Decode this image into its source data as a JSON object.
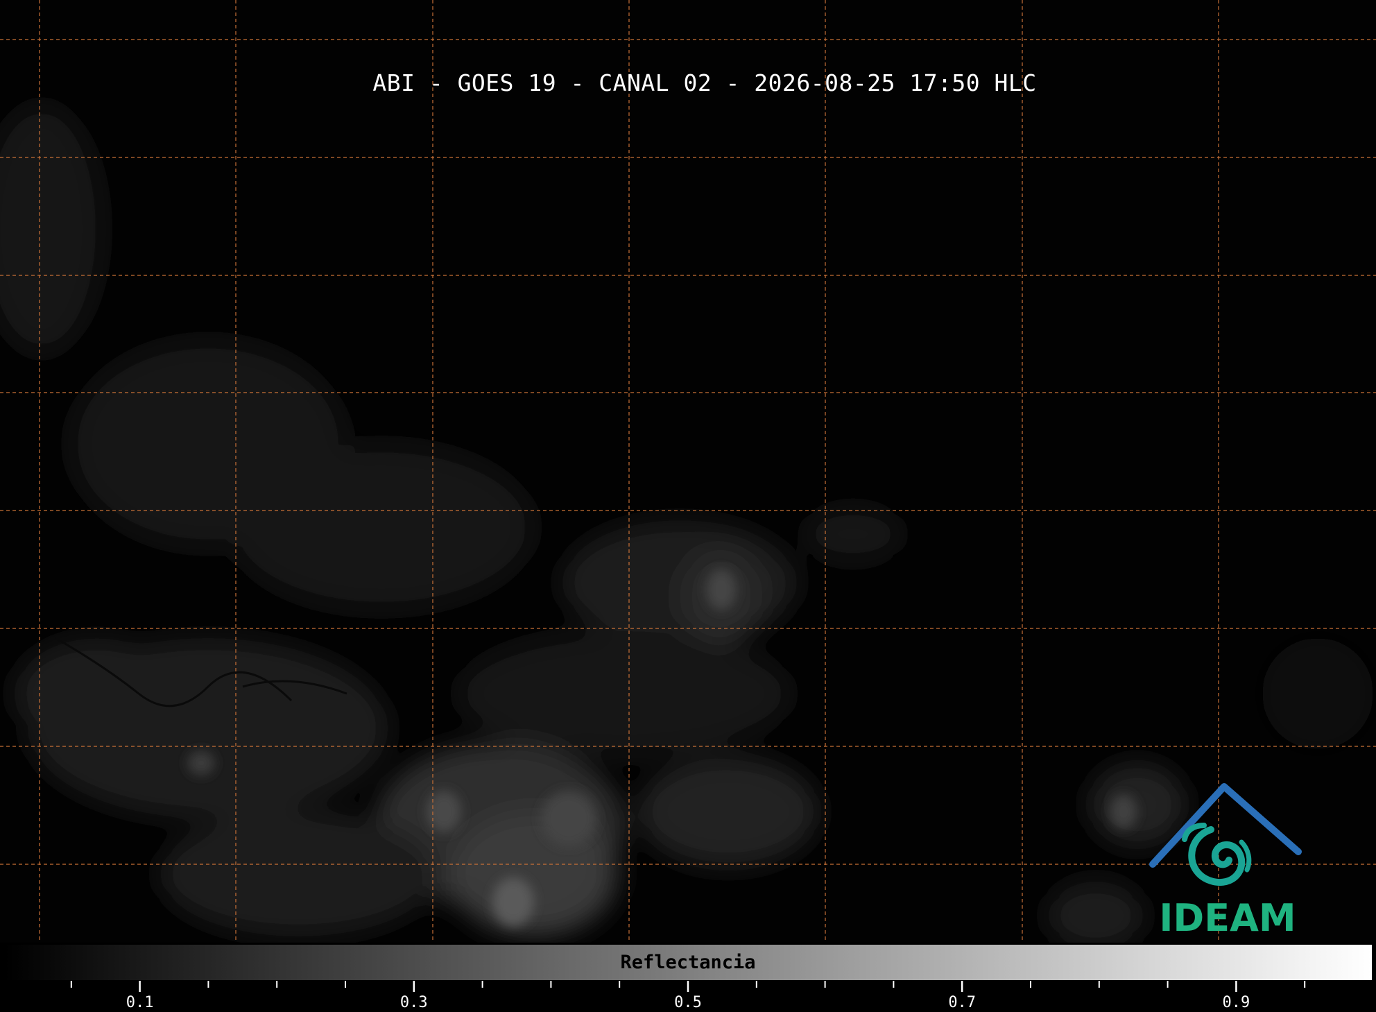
{
  "title": "ABI - GOES 19 - CANAL 02 - 2026-08-25 17:50 HLC",
  "gridline_color": "#c87137",
  "logo": {
    "text": "IDEAM",
    "text_color": "#1fb380",
    "roof_color": "#2a6fb8",
    "swirl_color": "#1aa595"
  },
  "colorbar": {
    "label": "Reflectancia",
    "range": [
      0.0,
      1.0
    ],
    "colormap": "gray",
    "color_low": "#000000",
    "color_high": "#ffffff",
    "major_ticks": [
      {
        "value": 0.1,
        "label": "0.1"
      },
      {
        "value": 0.3,
        "label": "0.3"
      },
      {
        "value": 0.5,
        "label": "0.5"
      },
      {
        "value": 0.7,
        "label": "0.7"
      },
      {
        "value": 0.9,
        "label": "0.9"
      }
    ],
    "minor_ticks": [
      0.05,
      0.15,
      0.2,
      0.25,
      0.35,
      0.4,
      0.45,
      0.55,
      0.6,
      0.65,
      0.75,
      0.8,
      0.85,
      0.95
    ]
  }
}
